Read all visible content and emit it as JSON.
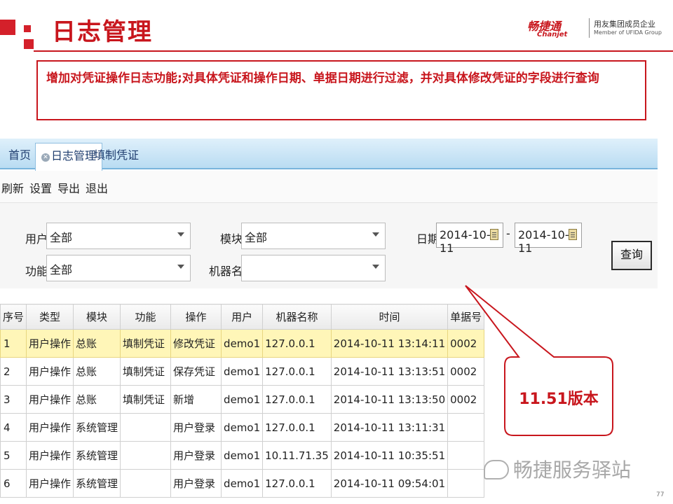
{
  "slide": {
    "title": "日志管理",
    "logo": {
      "brand": "畅捷通",
      "brand_en": "Chanjet",
      "line1": "用友集团成员企业",
      "line2": "Member of UFIDA Group"
    },
    "description": "增加对凭证操作日志功能;对具体凭证和操作日期、单据日期进行过滤，并对具体修改凭证的字段进行查询",
    "callout": "11.51版本",
    "watermark": "畅捷服务驿站",
    "page_number": "77",
    "accent_color": "#c8161d"
  },
  "app": {
    "tabs": [
      {
        "label": "首页",
        "active": false
      },
      {
        "label": "日志管理",
        "active": true,
        "closable": true
      },
      {
        "label": "填制凭证",
        "active": false
      }
    ],
    "menu": [
      "刷新",
      "设置",
      "导出",
      "退出"
    ],
    "filters": {
      "user": {
        "label": "用户",
        "value": "全部"
      },
      "module": {
        "label": "模块",
        "value": "全部"
      },
      "function": {
        "label": "功能",
        "value": "全部"
      },
      "machine": {
        "label": "机器名",
        "value": ""
      },
      "date": {
        "label": "日期",
        "from": "2014-10-11",
        "separator": "-",
        "to": "2014-10-11"
      },
      "query_button": "查询"
    },
    "grid": {
      "columns": [
        "序号",
        "类型",
        "模块",
        "功能",
        "操作",
        "用户",
        "机器名称",
        "时间",
        "单据号"
      ],
      "rows": [
        [
          "1",
          "用户操作",
          "总账",
          "填制凭证",
          "修改凭证",
          "demo1",
          "127.0.0.1",
          "2014-10-11 13:14:11",
          "0002"
        ],
        [
          "2",
          "用户操作",
          "总账",
          "填制凭证",
          "保存凭证",
          "demo1",
          "127.0.0.1",
          "2014-10-11 13:13:51",
          "0002"
        ],
        [
          "3",
          "用户操作",
          "总账",
          "填制凭证",
          "新增",
          "demo1",
          "127.0.0.1",
          "2014-10-11 13:13:50",
          "0002"
        ],
        [
          "4",
          "用户操作",
          "系统管理",
          "",
          "用户登录",
          "demo1",
          "127.0.0.1",
          "2014-10-11 13:11:31",
          ""
        ],
        [
          "5",
          "用户操作",
          "系统管理",
          "",
          "用户登录",
          "demo1",
          "10.11.71.35",
          "2014-10-11 10:35:51",
          ""
        ],
        [
          "6",
          "用户操作",
          "系统管理",
          "",
          "用户登录",
          "demo1",
          "127.0.0.1",
          "2014-10-11 09:54:01",
          ""
        ]
      ],
      "selected_row": 0
    }
  }
}
